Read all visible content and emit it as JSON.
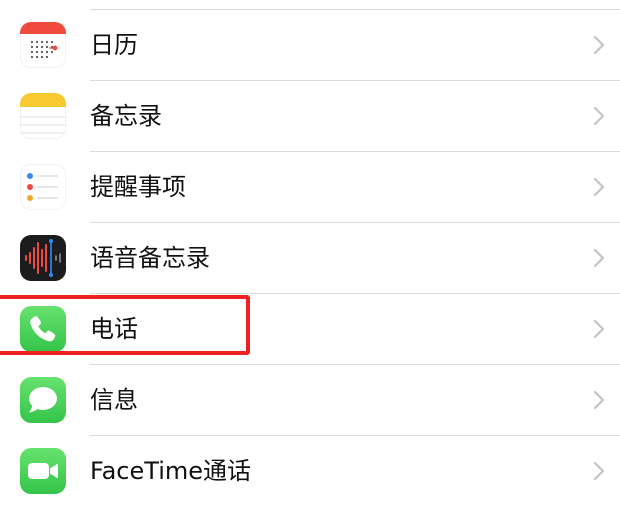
{
  "settings": {
    "items": [
      {
        "label": "日历",
        "icon": "calendar-icon"
      },
      {
        "label": "备忘录",
        "icon": "notes-icon"
      },
      {
        "label": "提醒事项",
        "icon": "reminders-icon"
      },
      {
        "label": "语音备忘录",
        "icon": "voice-memos-icon"
      },
      {
        "label": "电话",
        "icon": "phone-icon"
      },
      {
        "label": "信息",
        "icon": "messages-icon"
      },
      {
        "label": "FaceTime通话",
        "icon": "facetime-icon"
      }
    ]
  },
  "annotation": {
    "highlighted_item": "电话",
    "color": "#ee2020"
  },
  "colors": {
    "chevron": "#c4c4c7",
    "separator": "#dcdcdc",
    "calendar_red": "#f04a3e",
    "notes_yellow": "#f7ca2f",
    "phone_green": "#4cd964",
    "voice_memos_bg": "#1c1c1e"
  }
}
